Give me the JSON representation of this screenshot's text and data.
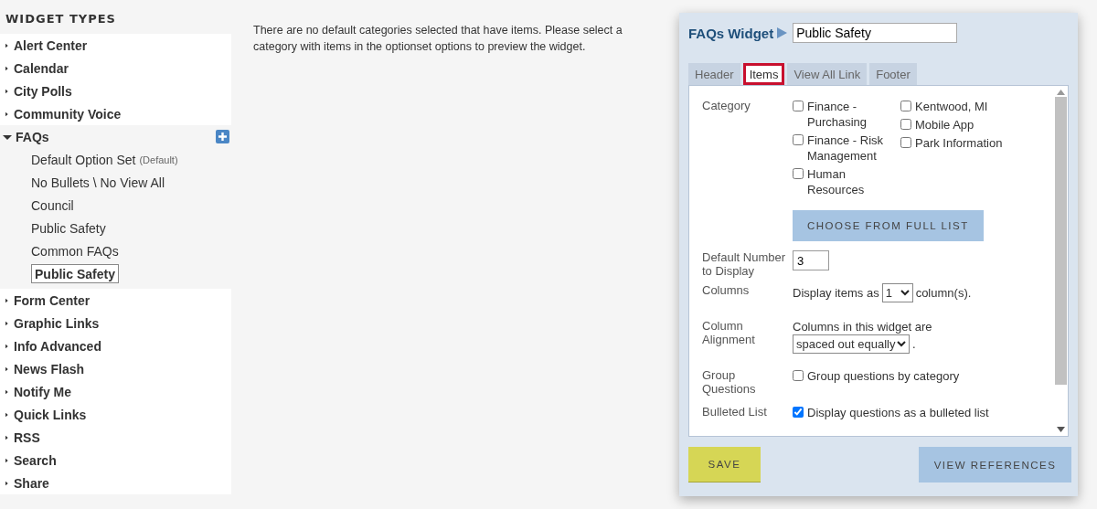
{
  "sidebar": {
    "heading": "WIDGET TYPES",
    "items": [
      {
        "label": "Alert Center",
        "expanded": false
      },
      {
        "label": "Calendar",
        "expanded": false
      },
      {
        "label": "City Polls",
        "expanded": false
      },
      {
        "label": "Community Voice",
        "expanded": false
      },
      {
        "label": "FAQs",
        "expanded": true,
        "children": [
          {
            "label": "Default Option Set",
            "tag": "(Default)",
            "selected": false
          },
          {
            "label": "No Bullets \\ No View All",
            "selected": false
          },
          {
            "label": "Council",
            "selected": false
          },
          {
            "label": "Public Safety",
            "selected": false
          },
          {
            "label": "Common FAQs",
            "selected": false
          },
          {
            "label": "Public Safety",
            "selected": true
          }
        ]
      },
      {
        "label": "Form Center",
        "expanded": false
      },
      {
        "label": "Graphic Links",
        "expanded": false
      },
      {
        "label": "Info Advanced",
        "expanded": false
      },
      {
        "label": "News Flash",
        "expanded": false
      },
      {
        "label": "Notify Me",
        "expanded": false
      },
      {
        "label": "Quick Links",
        "expanded": false
      },
      {
        "label": "RSS",
        "expanded": false
      },
      {
        "label": "Search",
        "expanded": false
      },
      {
        "label": "Share",
        "expanded": false
      }
    ]
  },
  "message": "There are no default categories selected that have items. Please select a category with items in the optionset options to preview the widget.",
  "panel": {
    "title": "FAQs Widget",
    "name_value": "Public Safety",
    "tabs": [
      {
        "label": "Header",
        "selected": false,
        "highlighted": false
      },
      {
        "label": "Items",
        "selected": true,
        "highlighted": true
      },
      {
        "label": "View All Link",
        "selected": false,
        "highlighted": false
      },
      {
        "label": "Footer",
        "selected": false,
        "highlighted": false
      }
    ],
    "fields": [
      {
        "kind": "checklist",
        "label": "Category",
        "columns": [
          [
            {
              "label": "Finance - Purchasing",
              "checked": false
            },
            {
              "label": "Finance - Risk Management",
              "checked": false
            },
            {
              "label": "Human Resources",
              "checked": false
            }
          ],
          [
            {
              "label": "Kentwood, MI",
              "checked": false
            },
            {
              "label": "Mobile App",
              "checked": false
            },
            {
              "label": "Park Information",
              "checked": false
            }
          ]
        ],
        "button": "CHOOSE FROM FULL LIST"
      },
      {
        "kind": "number",
        "label": "Default Number to Display",
        "value": "3"
      },
      {
        "kind": "select",
        "label": "Columns",
        "before": "Display items as",
        "value": "1",
        "after": "column(s)."
      },
      {
        "kind": "select-below",
        "label": "Column Alignment",
        "before": "Columns in this widget are",
        "value": "spaced out equally",
        "after": "."
      },
      {
        "kind": "checkbox",
        "label": "Group Questions",
        "text": "Group questions by category",
        "checked": false
      },
      {
        "kind": "checkbox",
        "label": "Bulleted List",
        "text": "Display questions as a bulleted list",
        "checked": true
      }
    ],
    "buttons": {
      "save": "SAVE",
      "references": "VIEW REFERENCES"
    }
  }
}
